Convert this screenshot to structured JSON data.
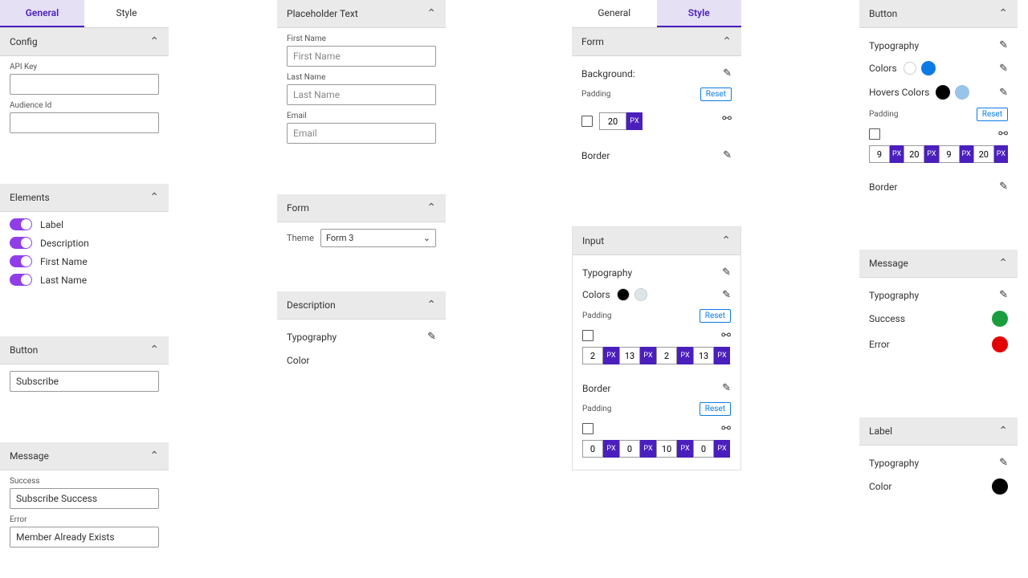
{
  "tabs": {
    "general": "General",
    "style": "Style"
  },
  "col1": {
    "config": {
      "title": "Config",
      "api_key": "API Key",
      "audience": "Audience Id"
    },
    "elements": {
      "title": "Elements",
      "items": [
        {
          "label": "Label"
        },
        {
          "label": "Description"
        },
        {
          "label": "First Name"
        },
        {
          "label": "Last Name"
        }
      ]
    },
    "button": {
      "title": "Button",
      "value": "Subscribe"
    },
    "message": {
      "title": "Message",
      "success_label": "Success",
      "success_value": "Subscribe Success",
      "error_label": "Error",
      "error_value": "Member Already Exists"
    }
  },
  "col2": {
    "placeholder": {
      "title": "Placeholder Text",
      "fields": [
        {
          "label": "First Name",
          "ph": "First Name"
        },
        {
          "label": "Last Name",
          "ph": "Last Name"
        },
        {
          "label": "Email",
          "ph": "Email"
        }
      ]
    },
    "form": {
      "title": "Form",
      "theme_label": "Theme",
      "theme_value": "Form 3"
    },
    "description": {
      "title": "Description",
      "typography": "Typography",
      "color_label": "Color",
      "color": "#000000"
    }
  },
  "col3": {
    "form": {
      "title": "Form",
      "background": "Background:",
      "padding": "Padding",
      "reset": "Reset",
      "value": "20",
      "unit": "PX",
      "border": "Border"
    },
    "input": {
      "title": "Input",
      "typography": "Typography",
      "colors_label": "Colors",
      "colors": [
        "#000000",
        "#dce6ea"
      ],
      "padding": "Padding",
      "reset": "Reset",
      "pad_vals": [
        "2",
        "13",
        "2",
        "13"
      ],
      "unit": "PX",
      "border": "Border",
      "border_padding": "Padding",
      "border_vals": [
        "0",
        "0",
        "10",
        "0"
      ]
    }
  },
  "col4": {
    "button": {
      "title": "Button",
      "typography": "Typography",
      "colors_label": "Colors",
      "colors": [
        "#ffffff",
        "#0d7be5"
      ],
      "hover_label": "Hovers Colors",
      "hover_colors": [
        "#000000",
        "#97c4e8"
      ],
      "padding": "Padding",
      "reset": "Reset",
      "unit": "PX",
      "pad_vals": [
        "9",
        "20",
        "9",
        "20"
      ],
      "border": "Border"
    },
    "message": {
      "title": "Message",
      "typography": "Typography",
      "success": "Success",
      "success_color": "#1a9e3d",
      "error": "Error",
      "error_color": "#e30000"
    },
    "label_sec": {
      "title": "Label",
      "typography": "Typography",
      "color_label": "Color",
      "color": "#000000"
    }
  }
}
